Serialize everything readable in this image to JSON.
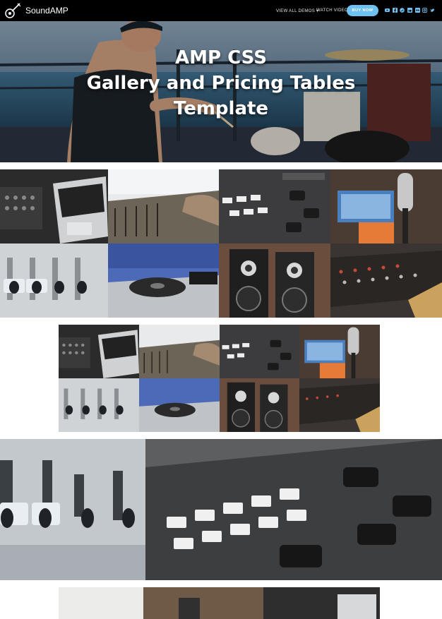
{
  "nav": {
    "brand": "SoundAMP",
    "links": [
      "VIEW ALL DEMOS ▾",
      "WATCH VIDEO"
    ],
    "buy_label": "BUY NOW",
    "social_icons": [
      "youtube-icon",
      "facebook-icon",
      "twitter-icon",
      "linkedin-icon",
      "flickr-icon",
      "instagram-icon",
      "twitter-icon"
    ]
  },
  "hero": {
    "title": "AMP CSS\nGallery and Pricing Tables\nTemplate"
  },
  "gallery": {
    "images": [
      "mixer-laptop",
      "console-hands",
      "fader-board",
      "studio-microphone",
      "mixer-channels",
      "dj-turntable",
      "studio-speakers",
      "mixing-console"
    ]
  },
  "colors": {
    "nav_bg": "#000000",
    "accent": "#6ec1f0"
  }
}
